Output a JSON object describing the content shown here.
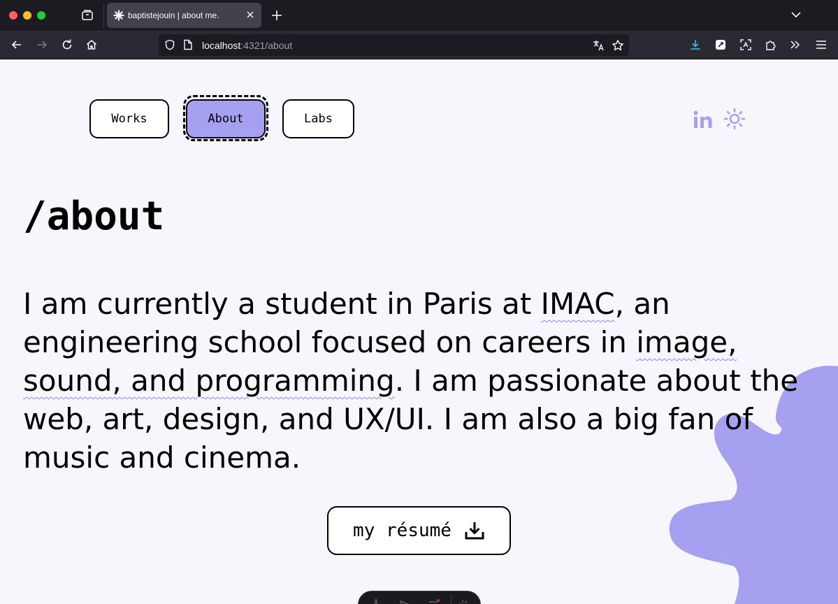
{
  "browser": {
    "tab_title": "baptistejouin | about me.",
    "url_host": "localhost",
    "url_rest": ":4321/about"
  },
  "nav": {
    "works": "Works",
    "about": "About",
    "labs": "Labs",
    "active": "About"
  },
  "social": {
    "linkedin_icon": "linkedin-icon",
    "theme_icon": "sun-icon"
  },
  "page": {
    "title": "/about",
    "bio": {
      "p1": "I am currently a student in Paris at ",
      "imac": "IMAC",
      "p2": ", an engineering school focused on careers in ",
      "image": "image,",
      "p3": " ",
      "sound": "sound, and programming",
      "p4": ". I am passionate about the web, art, design, and UX/UI. I am also a big fan of music and cinema."
    },
    "resume_label": "my résumé"
  },
  "colors": {
    "accent": "#a5a1f0",
    "background": "#f7f6fd",
    "text": "#000000"
  }
}
